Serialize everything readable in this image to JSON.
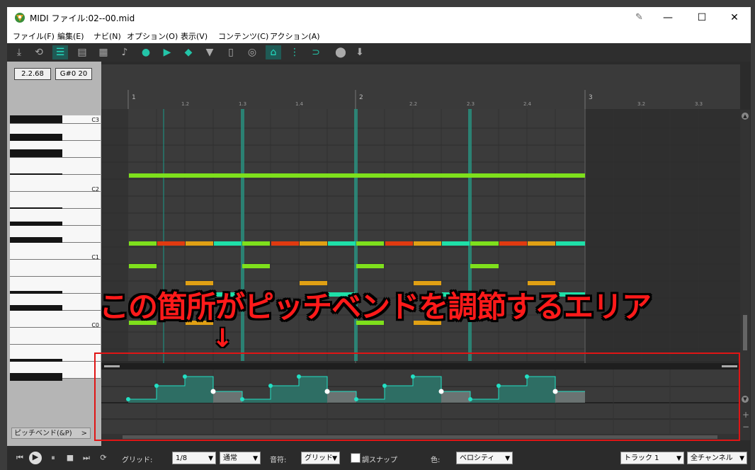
{
  "window": {
    "title": "MIDI ファイル:02--00.mid",
    "pin_icon": "pin-icon",
    "controls": {
      "minimize": "—",
      "maximize": "☐",
      "close": "✕"
    }
  },
  "menu": [
    "ファイル(F)",
    "編集(E)",
    "ナビ(N)",
    "オプション(O)",
    "表示(V)",
    "コンテンツ(C)",
    "アクション(A)"
  ],
  "toolbar": {
    "icons": [
      "insert-icon",
      "loop-icon",
      "piano-roll-view-icon",
      "named-notes-view-icon",
      "event-list-view-icon",
      "notation-icon",
      "track-list-icon",
      "play-icon",
      "color-icon",
      "filter-icon",
      "list-icon",
      "quantize-icon",
      "snap-icon",
      "grid-icon",
      "magnet-icon",
      "step-record-icon",
      "input-icon"
    ]
  },
  "status": {
    "position": "2.2.68",
    "note": "G#0  20"
  },
  "piano": {
    "octave_labels": [
      "C3",
      "C2",
      "C1",
      "C0"
    ]
  },
  "ruler": {
    "bars": [
      "1",
      "2",
      "3"
    ],
    "beats": [
      "1.2",
      "1.3",
      "1.4",
      "2.2",
      "2.3",
      "2.4",
      "3.2",
      "3.3"
    ]
  },
  "lane": {
    "label": "ピッチベンド(&P)",
    "chevron": ">"
  },
  "transport": {
    "grid_label": "グリッド:",
    "grid_value": "1/8",
    "grid_mode": "通常",
    "notes_label": "音符:",
    "notes_value": "グリッド",
    "key_snap_label": "調スナップ",
    "color_label": "色:",
    "color_value": "ベロシティ",
    "track_value": "トラック 1",
    "channel_value": "全チャンネル"
  },
  "annotation": {
    "text": "この箇所がピッチベンドを調節するエリア",
    "arrow": "↓",
    "box_color": "#e01515"
  },
  "colors": {
    "accent": "#23e0c4",
    "note_green": "#7ee01c",
    "note_teal": "#1ee0a8",
    "note_orange": "#e0a014",
    "note_red": "#e03a10",
    "pitch_fill": "#2e6e64"
  }
}
